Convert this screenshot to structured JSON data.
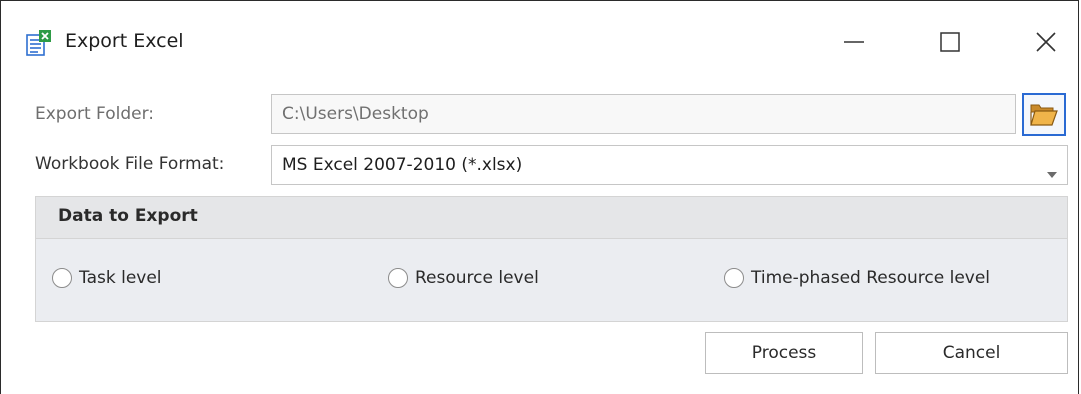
{
  "window": {
    "title": "Export Excel",
    "icons": {
      "app": "excel-export-icon",
      "minimize": "minimize-icon",
      "maximize": "maximize-icon",
      "close": "close-icon"
    }
  },
  "form": {
    "export_folder_label": "Export Folder:",
    "export_folder_value": "C:\\Users\\Desktop",
    "browse_icon": "folder-open-icon",
    "format_label": "Workbook File Format:",
    "format_value": "MS Excel 2007-2010 (*.xlsx)",
    "format_dropdown_icon": "chevron-down-icon"
  },
  "data_to_export": {
    "title": "Data to Export",
    "options": [
      {
        "label": "Task level",
        "selected": false
      },
      {
        "label": "Resource level",
        "selected": false
      },
      {
        "label": "Time-phased Resource level",
        "selected": false
      }
    ]
  },
  "buttons": {
    "process": "Process",
    "cancel": "Cancel"
  },
  "colors": {
    "focus_border": "#2a6ad3",
    "group_background": "#ebedf1",
    "label_gray": "#6e6e6e"
  }
}
